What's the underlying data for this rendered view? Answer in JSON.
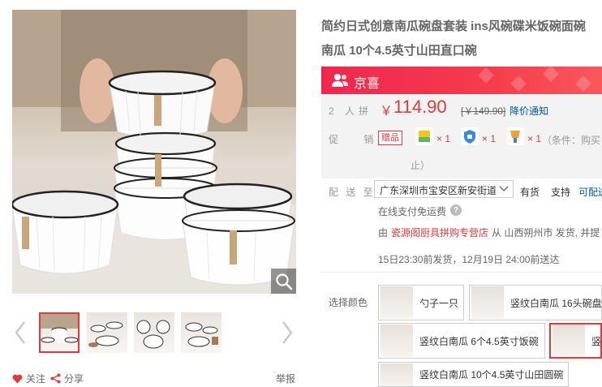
{
  "product": {
    "title_line1": "简约日式创意南瓜碗盘套装 ins风碗碟米饭碗面碗",
    "title_line2": "南瓜 10个4.5英寸山田直口碗"
  },
  "banner": {
    "label": "京喜",
    "icon": "user-group-icon",
    "color": "#f0264f"
  },
  "price": {
    "group_label": "2 人拼",
    "symbol": "￥",
    "value": "114.90",
    "original": "[￥149.90]",
    "notify_label": "降价通知"
  },
  "promo": {
    "label": "促 销",
    "tag": "赠品",
    "gifts": [
      {
        "icon": "gift-sponge-icon",
        "qty": "× 1"
      },
      {
        "icon": "gift-box-icon",
        "qty": "× 1"
      },
      {
        "icon": "gift-brush-icon",
        "qty": "× 1"
      }
    ],
    "condition_line1": "（条件：购买",
    "condition_line2": "止）"
  },
  "delivery": {
    "label": "配 送 至",
    "address": "广东深圳市宝安区新安街道",
    "stock": "有货",
    "support_label": "支持",
    "support_link": "可配送",
    "shipping_note": "在线支付免运费",
    "seller_prefix": "由",
    "seller_name": "瓷源阁厨具拼购专营店",
    "seller_suffix": "从 山西朔州市 发货, 并提",
    "eta": "15日23:30前发货，12月19日 24:00前送达"
  },
  "options": {
    "label": "选择颜色",
    "items": [
      {
        "label": "勺子一只",
        "selected": false
      },
      {
        "label": "竖纹白南瓜 16头碗盘套",
        "selected": false
      },
      {
        "label": "竖纹白南瓜 6个4.5英寸饭碗",
        "selected": false
      },
      {
        "label": "竖纹",
        "selected": true
      },
      {
        "label": "竖纹白南瓜 10个4.5英寸山田圆碗",
        "selected": false
      }
    ]
  },
  "gallery": {
    "zoom_icon": "magnifier-icon",
    "thumbnails": 4,
    "follow_label": "关注",
    "share_label": "分享",
    "report_label": "举报"
  },
  "colors": {
    "accent": "#e4393c",
    "link": "#005aa0"
  }
}
